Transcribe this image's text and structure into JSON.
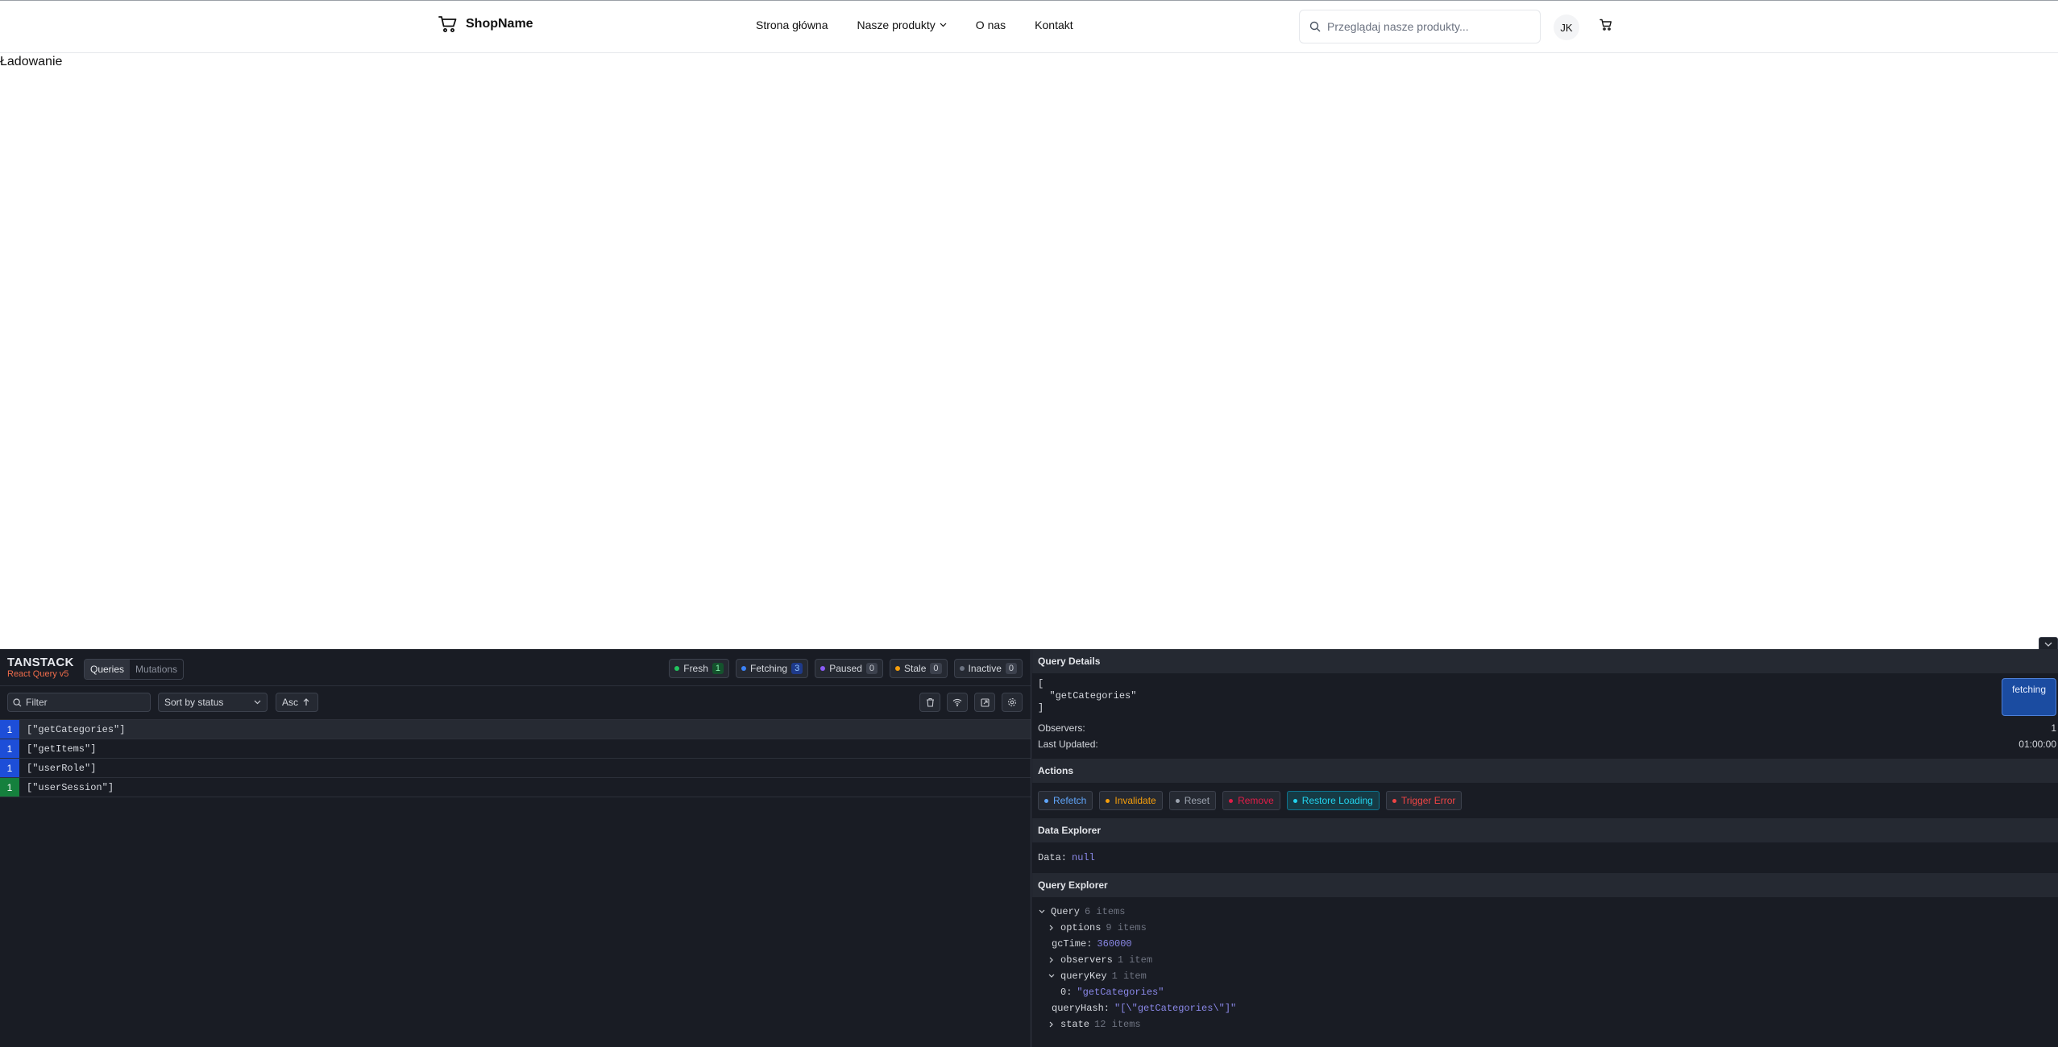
{
  "nav": {
    "brand": "ShopName",
    "links": [
      "Strona główna",
      "Nasze produkty",
      "O nas",
      "Kontakt"
    ],
    "search_placeholder": "Przeglądaj nasze produkty...",
    "avatar_initials": "JK"
  },
  "main": {
    "loading_text": "Ładowanie"
  },
  "devtools": {
    "logo_title": "TANSTACK",
    "logo_subtitle": "React Query v5",
    "tabs": [
      "Queries",
      "Mutations"
    ],
    "statuses": [
      {
        "label": "Fresh",
        "count": "1",
        "color": "#22c55e",
        "count_bg": "#14532d",
        "count_color": "#86efac"
      },
      {
        "label": "Fetching",
        "count": "3",
        "color": "#3b82f6",
        "count_bg": "#1e3a8a",
        "count_color": "#93c5fd"
      },
      {
        "label": "Paused",
        "count": "0",
        "color": "#8b5cf6",
        "count_bg": "#3c414d",
        "count_color": "#c9ccd3"
      },
      {
        "label": "Stale",
        "count": "0",
        "color": "#f59e0b",
        "count_bg": "#3c414d",
        "count_color": "#c9ccd3"
      },
      {
        "label": "Inactive",
        "count": "0",
        "color": "#6b7280",
        "count_bg": "#3c414d",
        "count_color": "#c9ccd3"
      }
    ],
    "filter_placeholder": "Filter",
    "sort_label": "Sort by status",
    "order_label": "Asc",
    "queries": [
      {
        "count": "1",
        "key": "[\"getCategories\"]",
        "color": "#1d4ed8"
      },
      {
        "count": "1",
        "key": "[\"getItems\"]",
        "color": "#1d4ed8"
      },
      {
        "count": "1",
        "key": "[\"userRole\"]",
        "color": "#1d4ed8"
      },
      {
        "count": "1",
        "key": "[\"userSession\"]",
        "color": "#15803d"
      }
    ],
    "details": {
      "title": "Query Details",
      "key_lines": [
        "[",
        "  \"getCategories\"",
        "]"
      ],
      "status_badge": "fetching",
      "observers_label": "Observers:",
      "observers_value": "1",
      "last_updated_label": "Last Updated:",
      "last_updated_value": "01:00:00"
    },
    "actions": {
      "title": "Actions",
      "buttons": [
        {
          "label": "Refetch",
          "color": "#60a5fa"
        },
        {
          "label": "Invalidate",
          "color": "#f59e0b"
        },
        {
          "label": "Reset",
          "color": "#9ca3af"
        },
        {
          "label": "Remove",
          "color": "#e11d48"
        },
        {
          "label": "Restore Loading",
          "color": "#22d3ee"
        },
        {
          "label": "Trigger Error",
          "color": "#ef4444"
        }
      ]
    },
    "data_explorer": {
      "title": "Data Explorer",
      "label": "Data:",
      "value": "null"
    },
    "query_explorer": {
      "title": "Query Explorer",
      "root_label": "Query",
      "root_meta": "6 items",
      "options_label": "options",
      "options_meta": "9 items",
      "gc_label": "gcTime:",
      "gc_value": "360000",
      "observers_label": "observers",
      "observers_meta": "1 item",
      "querykey_label": "queryKey",
      "querykey_meta": "1 item",
      "querykey_item_label": "0:",
      "querykey_item_value": "\"getCategories\"",
      "queryhash_label": "queryHash:",
      "queryhash_value": "\"[\\\"getCategories\\\"]\"",
      "state_label": "state",
      "state_meta": "12 items"
    }
  }
}
